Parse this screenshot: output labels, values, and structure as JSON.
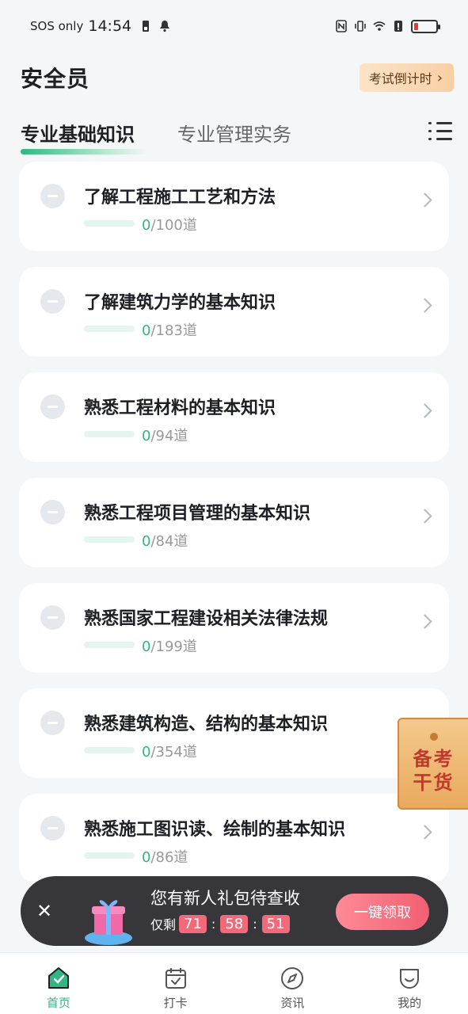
{
  "status_bar": {
    "sos": "SOS only",
    "time": "14:54"
  },
  "header": {
    "title": "安全员",
    "countdown_label": "考试倒计时"
  },
  "tabs": [
    {
      "label": "专业基础知识",
      "active": true
    },
    {
      "label": "专业管理实务",
      "active": false
    }
  ],
  "chapters": [
    {
      "title": "了解工程施工工艺和方法",
      "done": "0",
      "total": "/100道"
    },
    {
      "title": "了解建筑力学的基本知识",
      "done": "0",
      "total": "/183道"
    },
    {
      "title": "熟悉工程材料的基本知识",
      "done": "0",
      "total": "/94道"
    },
    {
      "title": "熟悉工程项目管理的基本知识",
      "done": "0",
      "total": "/84道"
    },
    {
      "title": "熟悉国家工程建设相关法律法规",
      "done": "0",
      "total": "/199道"
    },
    {
      "title": "熟悉建筑构造、结构的基本知识",
      "done": "0",
      "total": "/354道"
    },
    {
      "title": "熟悉施工图识读、绘制的基本知识",
      "done": "0",
      "total": "/86道"
    }
  ],
  "float_tag": {
    "line1": "备考",
    "line2": "干货"
  },
  "promo": {
    "headline": "您有新人礼包待查收",
    "remaining_label": "仅剩",
    "hours": "71",
    "minutes": "58",
    "seconds": "51",
    "claim_label": "一键领取"
  },
  "bottom_nav": [
    {
      "label": "首页",
      "active": true
    },
    {
      "label": "打卡",
      "active": false
    },
    {
      "label": "资讯",
      "active": false
    },
    {
      "label": "我的",
      "active": false
    }
  ],
  "colors": {
    "accent": "#2fb883",
    "promo_red": "#f25f73"
  }
}
